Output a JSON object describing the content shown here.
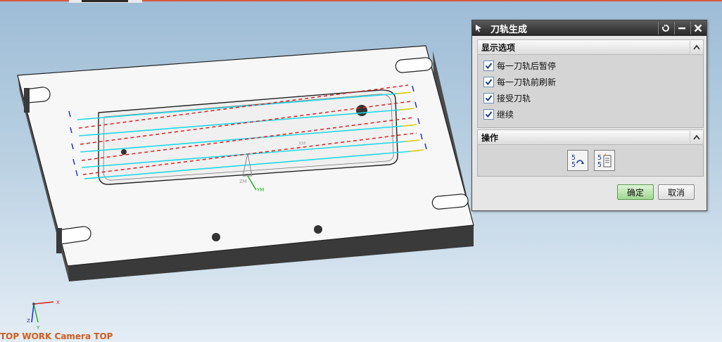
{
  "viewport": {
    "status_text": "TOP WORK Camera TOP",
    "wcs_x_label": "XM",
    "wcs_y_label": "YM",
    "wcs_z_label": "ZM",
    "triad_x": "X",
    "triad_y": "Y",
    "triad_z": "Z"
  },
  "dialog": {
    "title": "刀轨生成",
    "title_icon": "select-arrow-icon",
    "reset_icon": "reset-icon",
    "minimize_icon": "minimize-icon",
    "close_icon": "close-icon",
    "display_section": {
      "label": "显示选项",
      "options": [
        {
          "label": "每一刀轨后暂停",
          "checked": true
        },
        {
          "label": "每一刀轨前刷新",
          "checked": true
        },
        {
          "label": "接受刀轨",
          "checked": true
        },
        {
          "label": "继续",
          "checked": true
        }
      ]
    },
    "operation_section": {
      "label": "操作",
      "buttons": [
        {
          "icon": "replay-toolpath-icon"
        },
        {
          "icon": "list-toolpath-icon"
        }
      ]
    },
    "ok_label": "确定",
    "cancel_label": "取消"
  },
  "colors": {
    "toolpath_cut": "#21d8e8",
    "toolpath_rapid": "#e02020",
    "toolpath_engage": "#e8d020",
    "toolpath_approach": "#1a2fd0",
    "status_text": "#d65a1b",
    "ok_button": "#9fd693"
  }
}
